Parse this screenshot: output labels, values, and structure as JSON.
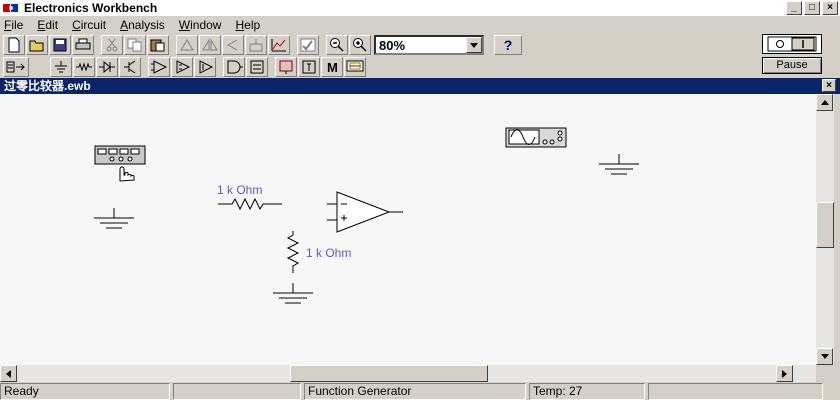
{
  "app": {
    "title": "Electronics Workbench"
  },
  "window_controls": {
    "minimize": "_",
    "restore": "□",
    "close": "×"
  },
  "menu": [
    {
      "label": "File",
      "key": "F",
      "rest": "ile"
    },
    {
      "label": "Edit",
      "key": "E",
      "rest": "dit"
    },
    {
      "label": "Circuit",
      "key": "C",
      "rest": "ircuit"
    },
    {
      "label": "Analysis",
      "key": "A",
      "rest": "nalysis"
    },
    {
      "label": "Window",
      "key": "W",
      "rest": "indow"
    },
    {
      "label": "Help",
      "key": "H",
      "rest": "elp"
    }
  ],
  "toolbar": {
    "zoom": "80%",
    "help_label": "?"
  },
  "simulation": {
    "power_label": "O | 1",
    "pause_label": "Pause"
  },
  "document": {
    "title": "过零比较器.ewb",
    "close": "×"
  },
  "circuit": {
    "resistor1_label": "1 k Ohm",
    "resistor2_label": "1 k Ohm"
  },
  "status": {
    "state": "Ready",
    "component": "Function Generator",
    "temp": "Temp:  27"
  },
  "colors": {
    "title_active": "#0a246a",
    "component_label": "#5a5ac8",
    "face": "#d4d0c8"
  }
}
